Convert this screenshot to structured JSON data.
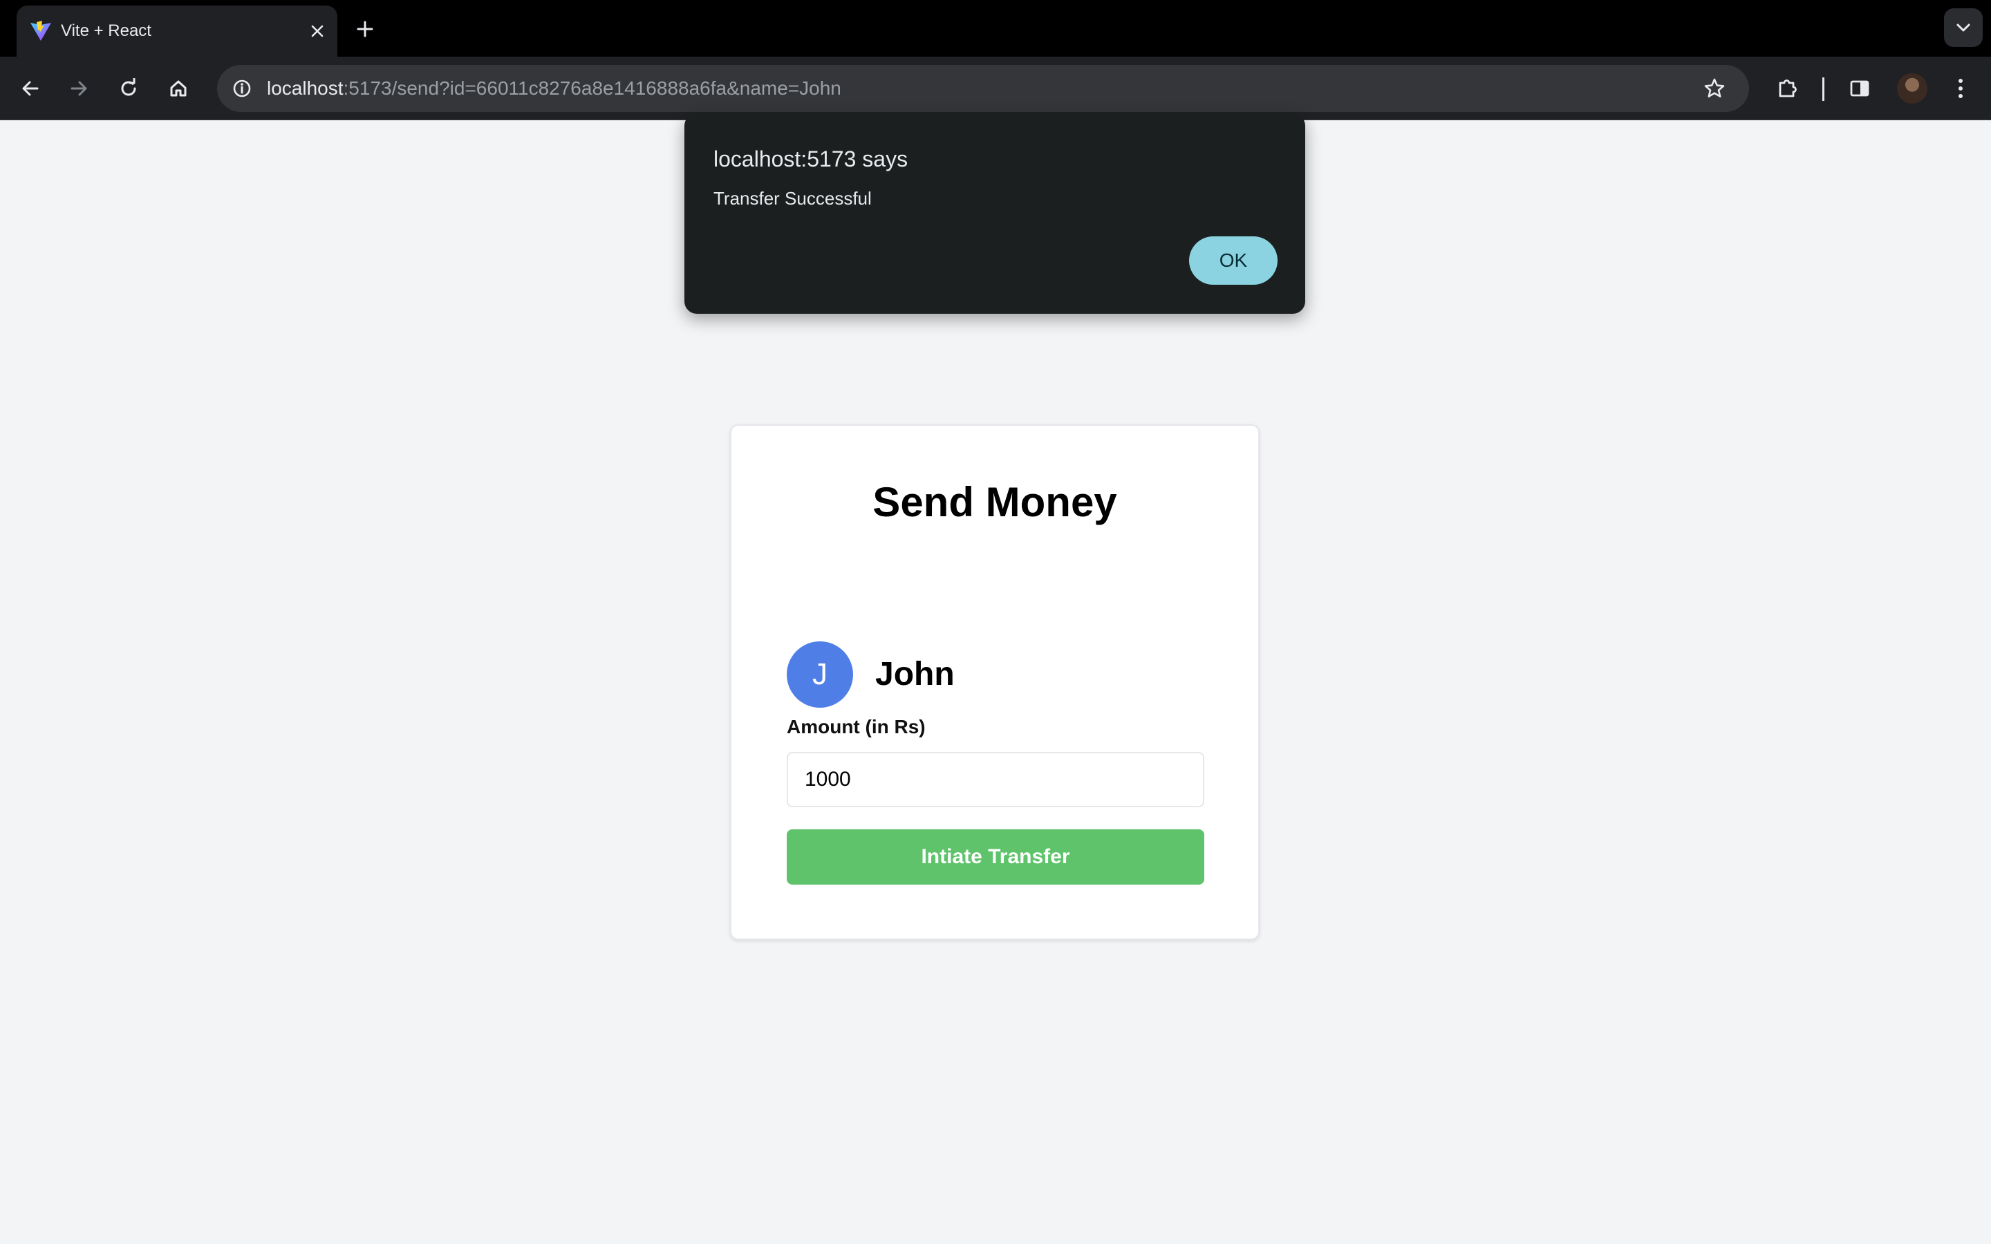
{
  "browser": {
    "tab": {
      "title": "Vite + React",
      "favicon": "vite-logo-icon"
    },
    "address_bar": {
      "host": "localhost",
      "rest": ":5173/send?id=66011c8276a8e1416888a6fa&name=John"
    },
    "icons": {
      "back": "back-arrow-icon",
      "forward": "forward-arrow-icon",
      "reload": "reload-icon",
      "home": "home-icon",
      "site_info": "info-icon",
      "bookmark": "star-icon",
      "extensions": "puzzle-icon",
      "side_panel": "side-panel-icon",
      "menu": "kebab-menu-icon"
    }
  },
  "alert": {
    "title": "localhost:5173 says",
    "message": "Transfer Successful",
    "ok_label": "OK"
  },
  "card": {
    "title": "Send Money",
    "recipient": {
      "initial": "J",
      "name": "John"
    },
    "amount_label": "Amount (in Rs)",
    "amount_value": "1000",
    "button_label": "Intiate Transfer"
  },
  "colors": {
    "page_background": "#f3f4f6",
    "avatar": "#4f7fe6",
    "transfer_button": "#5fc36b",
    "alert_background": "#1b1f20",
    "alert_ok_button": "#8bd3e0"
  }
}
